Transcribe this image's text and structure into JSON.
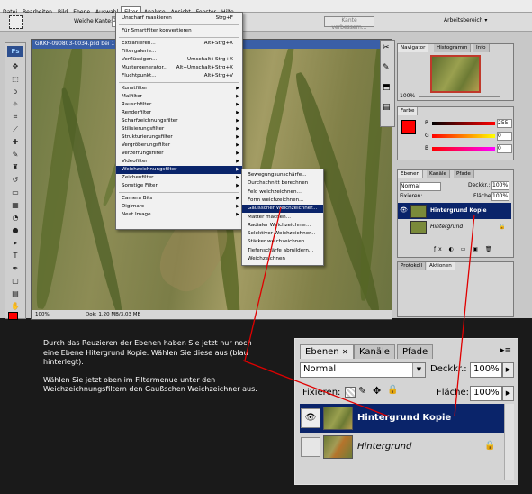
{
  "menubar": [
    "Datei",
    "Bearbeiten",
    "Bild",
    "Ebene",
    "Auswahl",
    "Filter",
    "Analyse",
    "Ansicht",
    "Fenster",
    "Hilfe"
  ],
  "options": {
    "soft_edge_label": "Weiche Kante:",
    "soft_edge_value": "0 px",
    "refine_button": "Kante verbessern...",
    "workspace_button": "Arbeitsbereich ▾"
  },
  "document": {
    "title": "GRKF-090803-0034.psd bei 1",
    "zoom": "100%",
    "status": "Dok: 1,20 MB/3,03 MB"
  },
  "filter_menu": {
    "items": [
      {
        "label": "Unscharf maskieren",
        "shortcut": "Strg+F",
        "arrow": false
      },
      {
        "sep": true
      },
      {
        "label": "Für Smartfilter konvertieren",
        "shortcut": "",
        "arrow": false
      },
      {
        "sep": true
      },
      {
        "label": "Extrahieren...",
        "shortcut": "Alt+Strg+X",
        "arrow": false
      },
      {
        "label": "Filtergalerie...",
        "shortcut": "",
        "arrow": false
      },
      {
        "label": "Verflüssigen...",
        "shortcut": "Umschalt+Strg+X",
        "arrow": false
      },
      {
        "label": "Mustergenerator...",
        "shortcut": "Alt+Umschalt+Strg+X",
        "arrow": false
      },
      {
        "label": "Fluchtpunkt...",
        "shortcut": "Alt+Strg+V",
        "arrow": false
      },
      {
        "sep": true
      },
      {
        "label": "Kunstfilter",
        "shortcut": "",
        "arrow": true
      },
      {
        "label": "Malfilter",
        "shortcut": "",
        "arrow": true
      },
      {
        "label": "Rauschfilter",
        "shortcut": "",
        "arrow": true
      },
      {
        "label": "Renderfilter",
        "shortcut": "",
        "arrow": true
      },
      {
        "label": "Scharfzeichnungsfilter",
        "shortcut": "",
        "arrow": true
      },
      {
        "label": "Stilisierungsfilter",
        "shortcut": "",
        "arrow": true
      },
      {
        "label": "Strukturierungsfilter",
        "shortcut": "",
        "arrow": true
      },
      {
        "label": "Vergröberungsfilter",
        "shortcut": "",
        "arrow": true
      },
      {
        "label": "Verzerrungsfilter",
        "shortcut": "",
        "arrow": true
      },
      {
        "label": "Videofilter",
        "shortcut": "",
        "arrow": true
      },
      {
        "label": "Weichzeichnungsfilter",
        "shortcut": "",
        "arrow": true,
        "selected": true
      },
      {
        "label": "Zeichenfilter",
        "shortcut": "",
        "arrow": true
      },
      {
        "label": "Sonstige Filter",
        "shortcut": "",
        "arrow": true
      },
      {
        "sep": true
      },
      {
        "label": "Camera Bits",
        "shortcut": "",
        "arrow": true
      },
      {
        "label": "Digimarc",
        "shortcut": "",
        "arrow": true
      },
      {
        "label": "Neat Image",
        "shortcut": "",
        "arrow": true
      }
    ]
  },
  "blur_submenu": {
    "items": [
      {
        "label": "Bewegungsunschärfe..."
      },
      {
        "label": "Durchschnitt berechnen"
      },
      {
        "label": "Feld weichzeichnen..."
      },
      {
        "label": "Form weichzeichnen..."
      },
      {
        "label": "Gaußscher Weichzeichner...",
        "selected": true
      },
      {
        "label": "Matter machen..."
      },
      {
        "label": "Radialer Weichzeichner..."
      },
      {
        "label": "Selektiver Weichzeichner..."
      },
      {
        "label": "Stärker weichzeichnen"
      },
      {
        "label": "Tiefenschärfe abmildern..."
      },
      {
        "label": "Weichzeichnen"
      }
    ]
  },
  "navigator": {
    "tabs": [
      "Navigator",
      "Histogramm",
      "Info"
    ],
    "zoom": "100%"
  },
  "color": {
    "tab": "Farbe",
    "r": "255",
    "g": "0",
    "b": "0",
    "accent": "#ff0000"
  },
  "layers_small": {
    "tabs": [
      "Ebenen",
      "Kanäle",
      "Pfade"
    ],
    "mode": "Normal",
    "opacity_label": "Deckkr.:",
    "opacity": "100%",
    "lock_label": "Fixieren:",
    "fill_label": "Fläche:",
    "fill": "100%",
    "layers": [
      "Hintergrund Kopie",
      "Hintergrund"
    ]
  },
  "bottom_tabs": [
    "Protokoll",
    "Aktionen"
  ],
  "note": {
    "p1": "Durch das Reuzieren der Ebenen haben Sie jetzt nur noch eine Ebene Hitergrund Kopie. Wählen Sie diese aus (blau hinterlegt).",
    "p2": "Wählen Sie jetzt oben im Filtermenue unter den Weichzeichnungsfiltern den Gaußschen Weichzeichner aus."
  },
  "layers_zoom": {
    "tabs": [
      "Ebenen",
      "Kanäle",
      "Pfade"
    ],
    "mode": "Normal",
    "opacity_label": "Deckkr.:",
    "opacity": "100%",
    "lock_label": "Fixieren:",
    "fill_label": "Fläche:",
    "fill": "100%",
    "layers": [
      {
        "name": "Hintergrund Kopie",
        "selected": true,
        "visible": true
      },
      {
        "name": "Hintergrund",
        "selected": false,
        "visible": false,
        "locked": true
      }
    ]
  },
  "colors": {
    "selection": "#0a246a",
    "arrow": "#e00000",
    "title": "#3a5fa7"
  }
}
